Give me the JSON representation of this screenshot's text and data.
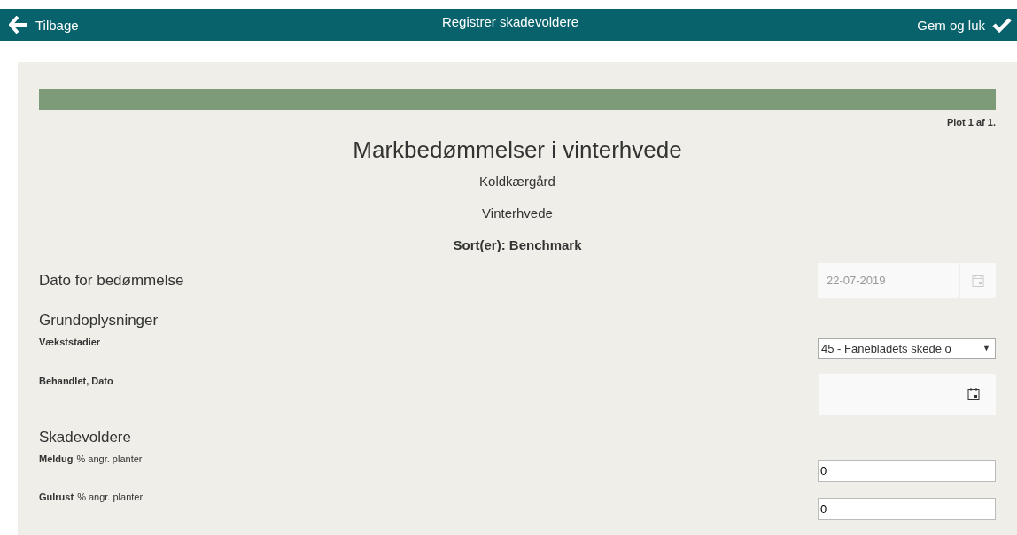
{
  "header": {
    "back": "Tilbage",
    "title": "Registrer skadevoldere",
    "save": "Gem og luk"
  },
  "plot": "Plot 1 af 1.",
  "form": {
    "title": "Markbedømmelser i vinterhvede",
    "subtitles": [
      "Koldkærgård",
      "Vinterhvede"
    ],
    "variety": "Sort(er): Benchmark",
    "date_row": {
      "label": "Dato for bedømmelse",
      "value": "22-07-2019",
      "disabled": true
    },
    "sections": [
      {
        "title": "Grundoplysninger",
        "fields": [
          {
            "kind": "select",
            "label": "Vækststadier",
            "value": "45 - Fanebladets skede o",
            "caret": "▼"
          },
          {
            "kind": "date",
            "label": "Behandlet, Dato"
          }
        ]
      },
      {
        "title": "Skadevoldere",
        "fields": [
          {
            "kind": "number",
            "label": "Meldug",
            "unit": "% angr. planter",
            "value": "0"
          },
          {
            "kind": "number",
            "label": "Gulrust",
            "unit": "% angr. planter",
            "value": "0"
          }
        ]
      }
    ]
  }
}
